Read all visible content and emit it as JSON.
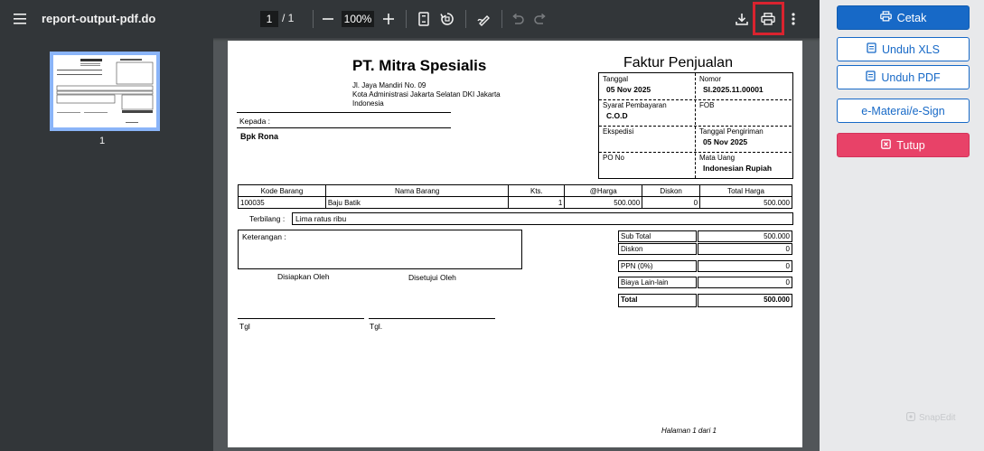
{
  "viewer": {
    "doc_title": "report-output-pdf.do",
    "page_current": "1",
    "page_sep": "/  1",
    "zoom": "100%",
    "thumbnail_label": "1"
  },
  "invoice": {
    "company_name": "PT. Mitra Spesialis",
    "address_lines": [
      "Jl. Jaya Mandiri No. 09",
      "Kota Administrasi Jakarta Selatan DKI Jakarta",
      "Indonesia"
    ],
    "kepada_label": "Kepada :",
    "kepada_value": "Bpk Rona",
    "title": "Faktur Penjualan",
    "header": {
      "tanggal_label": "Tanggal",
      "tanggal_value": "05 Nov 2025",
      "nomor_label": "Nomor",
      "nomor_value": "SI.2025.11.00001",
      "syarat_label": "Syarat Pembayaran",
      "syarat_value": "C.O.D",
      "fob_label": "FOB",
      "fob_value": "",
      "ekspedisi_label": "Ekspedisi",
      "ekspedisi_value": "",
      "tgl_kirim_label": "Tanggal Pengiriman",
      "tgl_kirim_value": "05 Nov 2025",
      "po_label": "PO No",
      "po_value": "",
      "mata_uang_label": "Mata Uang",
      "mata_uang_value": "Indonesian Rupiah"
    },
    "table": {
      "columns": [
        "Kode Barang",
        "Nama Barang",
        "Kts.",
        "@Harga",
        "Diskon",
        "Total Harga"
      ],
      "rows": [
        [
          "100035",
          "Baju Batik",
          "1",
          "500.000",
          "0",
          "500.000"
        ]
      ]
    },
    "terbilang_label": "Terbilang :",
    "terbilang_value": "Lima ratus ribu",
    "keterangan_label": "Keterangan :",
    "disiapkan": "Disiapkan Oleh",
    "disetujui": "Disetujui Oleh",
    "tgl1": "Tgl",
    "tgl2": "Tgl.",
    "summary": {
      "subtotal_label": "Sub Total",
      "subtotal_value": "500.000",
      "diskon_label": "Diskon",
      "diskon_value": "0",
      "ppn_label": "PPN (0%)",
      "ppn_value": "0",
      "biaya_label": "Biaya Lain-lain",
      "biaya_value": "0",
      "total_label": "Total",
      "total_value": "500.000"
    },
    "footer": "Halaman 1 dari  1"
  },
  "actions": {
    "cetak": "Cetak",
    "unduh_xls": "Unduh XLS",
    "unduh_pdf": "Unduh PDF",
    "emeterai": "e-Materai/e-Sign",
    "tutup": "Tutup"
  },
  "watermark": "SnapEdit",
  "colors": {
    "toolbar_bg": "#323639",
    "viewer_bg": "#525659",
    "primary": "#1769c7",
    "danger": "#e84268",
    "highlight": "#d9232f"
  }
}
